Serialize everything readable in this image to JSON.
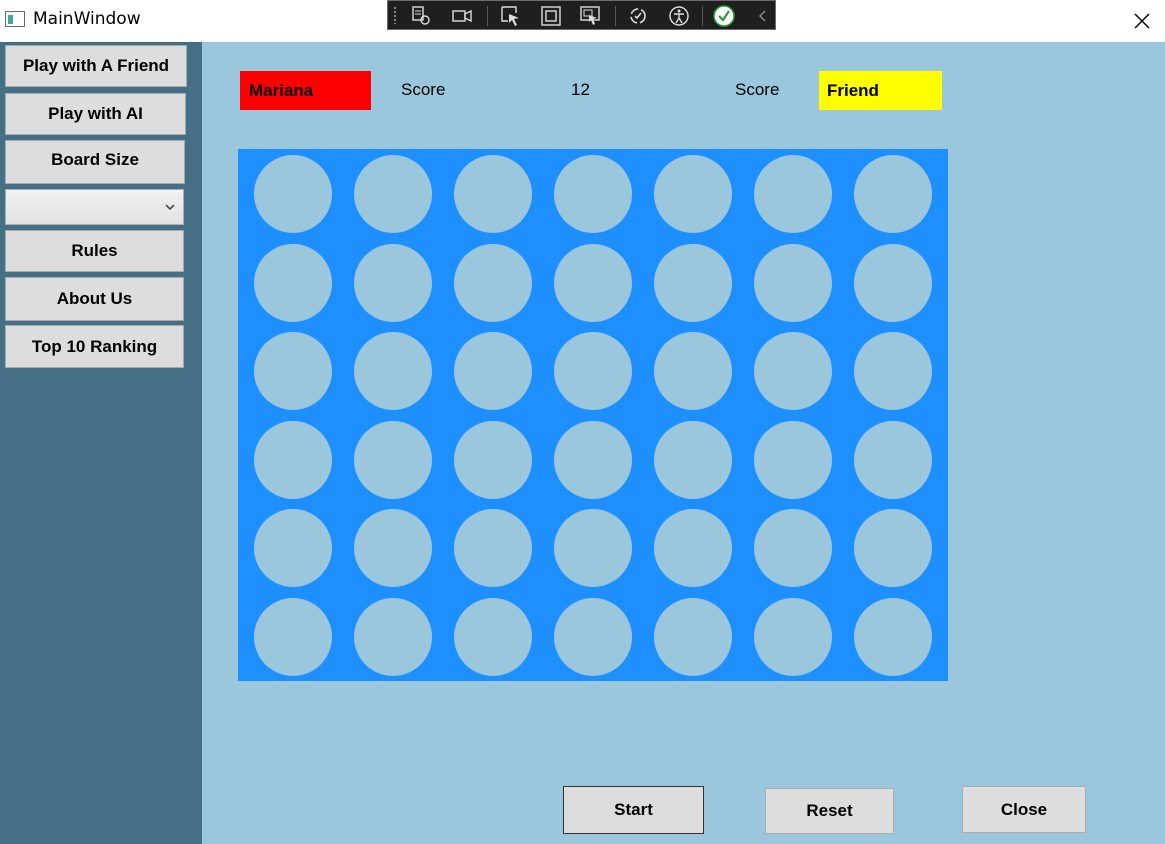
{
  "window": {
    "title": "MainWindow"
  },
  "devtools": {
    "tools": [
      "live-visual-tree-icon",
      "record-icon",
      "select-element-icon",
      "display-layout-adorners-icon",
      "track-focus-icon",
      "hot-reload-icon",
      "accessibility-icon",
      "binding-check-icon",
      "collapse-icon"
    ]
  },
  "sidebar": {
    "play_friend": "Play with A Friend",
    "play_ai": "Play with AI",
    "board_size": "Board Size",
    "board_size_value": "",
    "rules": "Rules",
    "about": "About Us",
    "ranking": "Top 10 Ranking"
  },
  "scoreboard": {
    "player1_name": "Mariana",
    "player1_color": "#ff0000",
    "score_label_left": "Score",
    "center_value": "12",
    "score_label_right": "Score",
    "player2_name": "Friend",
    "player2_color": "#ffff00"
  },
  "board": {
    "rows": 6,
    "columns": 7,
    "board_color": "#1e8fff",
    "empty_cell_color": "#9bc7dc"
  },
  "footer": {
    "start": "Start",
    "reset": "Reset",
    "close": "Close"
  }
}
